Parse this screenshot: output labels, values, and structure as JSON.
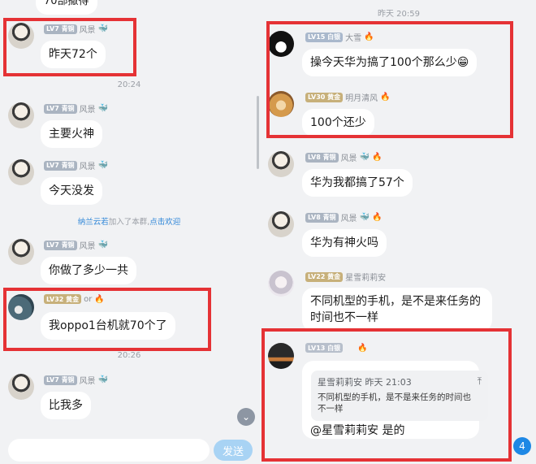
{
  "left": {
    "top_partial_text": "70部撒得",
    "messages": [
      {
        "level": "LV7",
        "rank": "青铜",
        "name": "风景",
        "text": "昨天72个"
      },
      {
        "level": "LV7",
        "rank": "青铜",
        "name": "风景",
        "text": "主要火神"
      },
      {
        "level": "LV7",
        "rank": "青铜",
        "name": "风景",
        "text": "今天没发"
      },
      {
        "level": "LV7",
        "rank": "青铜",
        "name": "风景",
        "text": "你做了多少一共"
      },
      {
        "level": "LV32",
        "rank": "黄金",
        "name": "or",
        "text": "我oppo1台机就70个了"
      },
      {
        "level": "LV7",
        "rank": "青铜",
        "name": "风景",
        "text": "比我多"
      }
    ],
    "times": [
      "20:24",
      "20:26"
    ],
    "system": {
      "name": "纳兰云若",
      "mid": "加入了本群,",
      "link": "点击欢迎"
    }
  },
  "right": {
    "time": "昨天 20:59",
    "messages": [
      {
        "level": "LV15",
        "rank": "白银",
        "name": "大雪",
        "text": "操今天华为搞了100个那么少😁"
      },
      {
        "level": "LV30",
        "rank": "黄金",
        "name": "明月清风",
        "text": "100个还少"
      },
      {
        "level": "LV8",
        "rank": "青铜",
        "name": "风景",
        "text": "华为我都搞了57个"
      },
      {
        "level": "LV8",
        "rank": "青铜",
        "name": "风景",
        "text": "华为有神火吗"
      },
      {
        "level": "LV22",
        "rank": "黄金",
        "name": "星雪莉莉安",
        "text": "不同机型的手机，是不是来任务的时间也不一样"
      },
      {
        "level": "LV13",
        "rank": "白银",
        "name": "",
        "text": "@星雪莉莉安 是的"
      }
    ],
    "quote": {
      "header": "星雪莉莉安 昨天 21:03",
      "text": "不同机型的手机，是不是来任务的时间也不一样"
    }
  },
  "input": {
    "placeholder": "",
    "send_label": "发送"
  },
  "unread_count": "4",
  "icons": {
    "fire": "🔥",
    "ship": "🐳",
    "pin": "⤒",
    "chevron": "⌄"
  },
  "colors": {
    "highlight_border": "#e53235",
    "send_button": "#a8d3f4",
    "link": "#2f86d8"
  }
}
